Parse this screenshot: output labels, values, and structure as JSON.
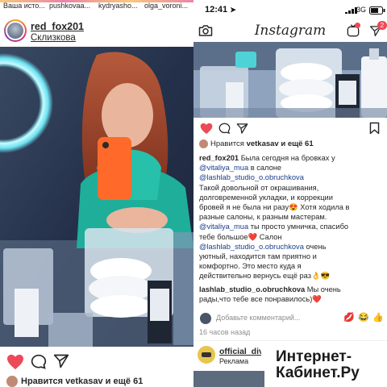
{
  "left": {
    "stories": [
      {
        "label": "Ваша исто..."
      },
      {
        "label": "pushkovaa..."
      },
      {
        "label": "kydryasho..."
      },
      {
        "label": "olga_voroni..."
      }
    ],
    "post": {
      "username": "red_fox201",
      "location": "Склизкова"
    },
    "likes_line": "Нравится vetkasav и ещё 61"
  },
  "right": {
    "status": {
      "time": "12:41",
      "network": "3G"
    },
    "header": {
      "title": "Instagram",
      "notification_count": "2"
    },
    "likes": {
      "prefix": "Нравится",
      "user": "vetkasav",
      "suffix": "и ещё 61"
    },
    "caption": {
      "lines": [
        {
          "parts": [
            {
              "t": "red_fox201",
              "s": "bold"
            },
            {
              "t": " Была сегодня на бровках у",
              "s": "plain"
            }
          ]
        },
        {
          "parts": [
            {
              "t": "@vitaliya_mua",
              "s": "mention"
            },
            {
              "t": " в салоне",
              "s": "plain"
            }
          ]
        },
        {
          "parts": [
            {
              "t": "@lashlab_studio_o.obruchkova",
              "s": "mention"
            }
          ]
        },
        {
          "parts": [
            {
              "t": "Такой довольной от окрашивания,",
              "s": "plain"
            }
          ]
        },
        {
          "parts": [
            {
              "t": "долговременной укладки, и коррекции",
              "s": "plain"
            }
          ]
        },
        {
          "parts": [
            {
              "t": "бровей я не была ни разу😍 Хотя ходила в",
              "s": "plain"
            }
          ]
        },
        {
          "parts": [
            {
              "t": "разные салоны, к разным мастерам.",
              "s": "plain"
            }
          ]
        },
        {
          "parts": [
            {
              "t": "@vitaliya_mua",
              "s": "mention"
            },
            {
              "t": " ты просто умничка, спасибо",
              "s": "plain"
            }
          ]
        },
        {
          "parts": [
            {
              "t": "тебе большое❤️ Салон",
              "s": "plain"
            }
          ]
        },
        {
          "parts": [
            {
              "t": "@lashlab_studio_o.obruchkova",
              "s": "mention"
            },
            {
              "t": " очень",
              "s": "plain"
            }
          ]
        },
        {
          "parts": [
            {
              "t": "уютный, находится там приятно и",
              "s": "plain"
            }
          ]
        },
        {
          "parts": [
            {
              "t": "комфортно. Это место куда я",
              "s": "plain"
            }
          ]
        },
        {
          "parts": [
            {
              "t": "действительно вернусь ещё раз👌😎",
              "s": "plain"
            }
          ]
        }
      ]
    },
    "reply": {
      "lines": [
        {
          "parts": [
            {
              "t": "lashlab_studio_o.obruchkova",
              "s": "bold"
            },
            {
              "t": " Мы очень",
              "s": "plain"
            }
          ]
        },
        {
          "parts": [
            {
              "t": "рады,что тебе все понравилось)❤️",
              "s": "plain"
            }
          ]
        }
      ]
    },
    "comment_input": {
      "placeholder": "Добавьте комментарий...",
      "emojis": [
        "💋",
        "😂",
        "👍"
      ]
    },
    "time_ago": "16 часов назад",
    "next_post": {
      "username": "official_div",
      "sponsored": "Реклама"
    }
  },
  "watermark": {
    "line1": "Интернет-",
    "line2": "Кабинет.Ру"
  }
}
